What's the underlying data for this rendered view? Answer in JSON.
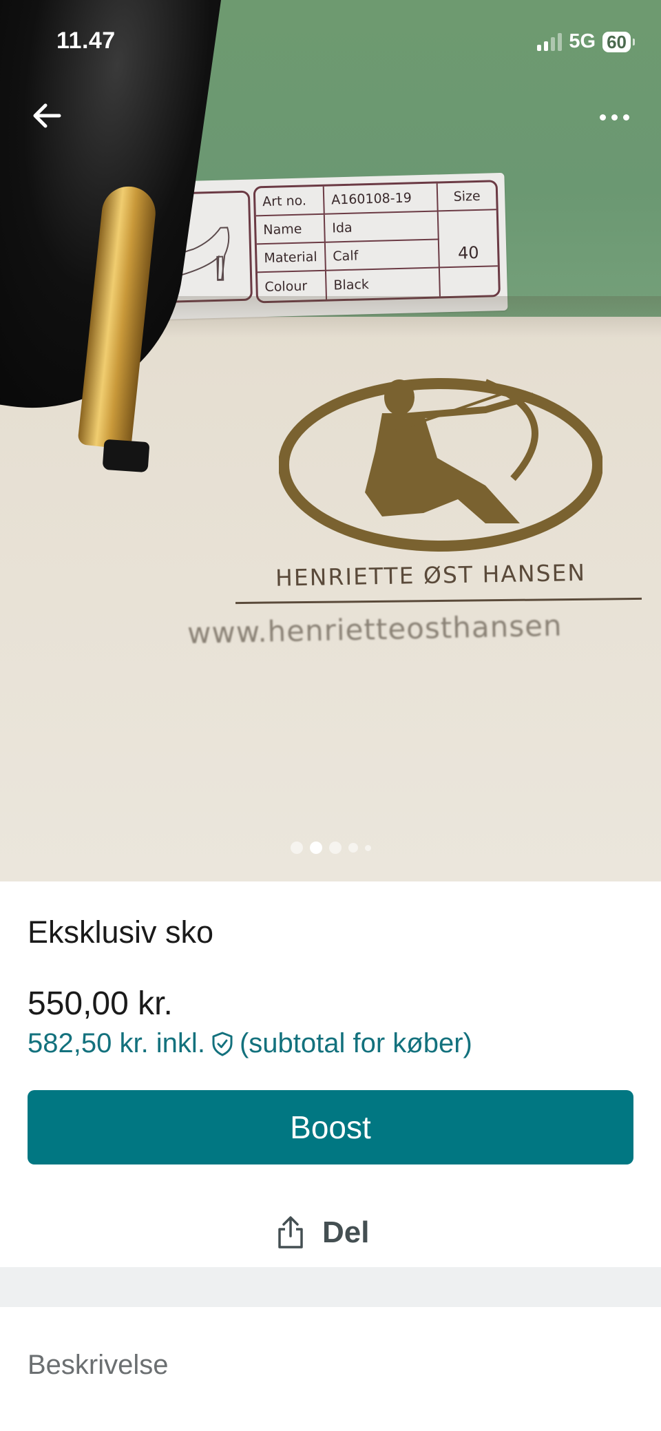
{
  "status_bar": {
    "time": "11.47",
    "network": "5G",
    "battery": "60"
  },
  "photo": {
    "label": {
      "art_no_label": "Art no.",
      "art_no_value": "A160108-19",
      "size_label": "Size",
      "name_label": "Name",
      "name_value": "Ida",
      "material_label": "Material",
      "material_value": "Calf",
      "size_value": "40",
      "colour_label": "Colour",
      "colour_value": "Black"
    },
    "brand_name": "HENRIETTE ØST HANSEN",
    "brand_url": "www.henrietteosthansen",
    "carousel": {
      "total": 5,
      "active_index": 1
    }
  },
  "listing": {
    "title": "Eksklusiv sko",
    "price": "550,00 kr.",
    "price_incl_prefix": "582,50 kr. inkl.",
    "price_incl_suffix": "(subtotal for køber)",
    "boost_label": "Boost",
    "share_label": "Del"
  },
  "description": {
    "heading": "Beskrivelse"
  },
  "colors": {
    "accent": "#017782",
    "accent_text": "#13717d",
    "box_green": "#6e9a70",
    "muted_text": "#6b6f71"
  },
  "icons": {
    "back": "arrow-left-icon",
    "more": "more-horizontal-icon",
    "buyer_protection": "shield-check-icon",
    "share": "share-icon"
  }
}
